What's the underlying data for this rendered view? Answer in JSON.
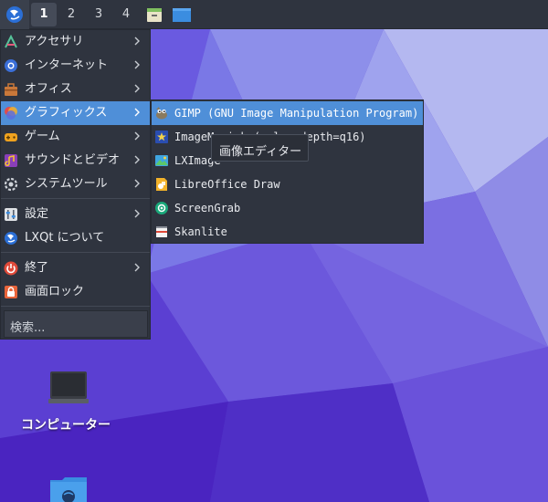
{
  "panel": {
    "start_icon": "lxqt-logo-icon",
    "workspaces": [
      "1",
      "2",
      "3",
      "4"
    ],
    "active_workspace": "1",
    "apps": [
      "file-manager-icon",
      "window-icon"
    ]
  },
  "menu": {
    "items": [
      {
        "label": "アクセサリ",
        "icon": "accessories-icon",
        "submenu": true
      },
      {
        "label": "インターネット",
        "icon": "internet-icon",
        "submenu": true
      },
      {
        "label": "オフィス",
        "icon": "office-icon",
        "submenu": true
      },
      {
        "label": "グラフィックス",
        "icon": "graphics-icon",
        "submenu": true,
        "highlighted": true
      },
      {
        "label": "ゲーム",
        "icon": "games-icon",
        "submenu": true
      },
      {
        "label": "サウンドとビデオ",
        "icon": "multimedia-icon",
        "submenu": true
      },
      {
        "label": "システムツール",
        "icon": "system-tools-icon",
        "submenu": true
      },
      {
        "label": "設定",
        "icon": "settings-icon",
        "submenu": true
      },
      {
        "label": "LXQt について",
        "icon": "lxqt-logo-icon",
        "submenu": false
      },
      {
        "label": "終了",
        "icon": "power-icon",
        "submenu": true
      },
      {
        "label": "画面ロック",
        "icon": "lock-icon",
        "submenu": false
      }
    ],
    "search_placeholder": "検索..."
  },
  "submenu": {
    "items": [
      {
        "label": "GIMP (GNU Image Manipulation Program)",
        "icon": "gimp-icon",
        "highlighted": true
      },
      {
        "label": "ImageMagick (color depth=q16)",
        "icon": "imagemagick-icon"
      },
      {
        "label": "LXImage",
        "icon": "lximage-icon"
      },
      {
        "label": "LibreOffice Draw",
        "icon": "libreoffice-draw-icon"
      },
      {
        "label": "ScreenGrab",
        "icon": "screengrab-icon"
      },
      {
        "label": "Skanlite",
        "icon": "skanlite-icon"
      }
    ]
  },
  "tooltip": {
    "text": "画像エディター"
  },
  "desktop": {
    "icons": [
      {
        "label": "コンピューター",
        "icon": "computer-icon"
      },
      {
        "label": "",
        "icon": "network-folder-icon"
      }
    ]
  },
  "colors": {
    "panel_bg": "#2f343f",
    "highlight": "#4f8fd8",
    "wallpaper": "#4a2bc4"
  }
}
